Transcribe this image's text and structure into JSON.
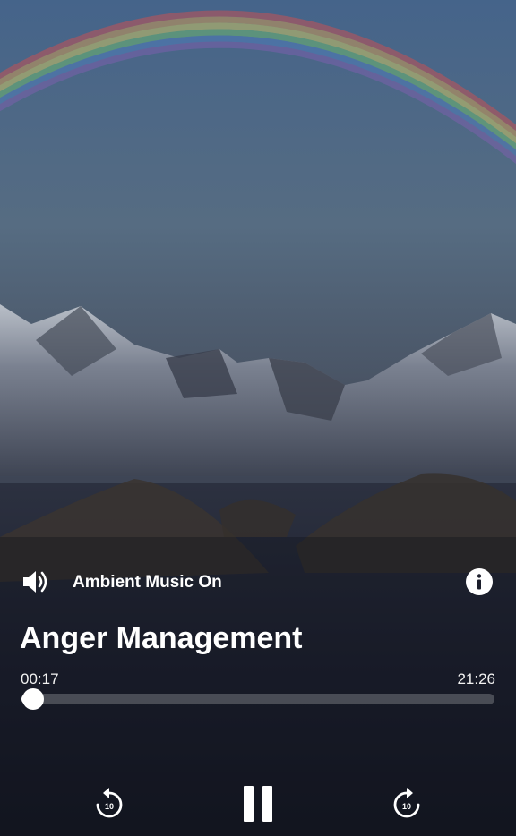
{
  "player": {
    "ambient_label": "Ambient Music On",
    "title": "Anger Management",
    "current_time": "00:17",
    "total_time": "21:26",
    "progress_fraction": 0.0133
  },
  "icons": {
    "sound": "speaker-icon",
    "info": "info-icon",
    "rewind": "rewind-10-icon",
    "pause": "pause-icon",
    "forward": "forward-10-icon"
  },
  "controls": {
    "rewind_seconds": "10",
    "forward_seconds": "10"
  }
}
